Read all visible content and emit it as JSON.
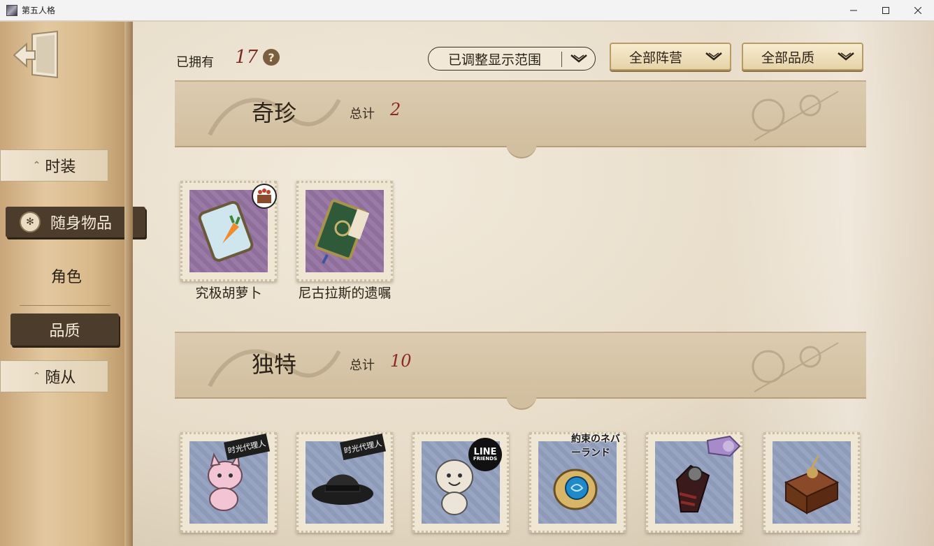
{
  "window": {
    "title": "第五人格",
    "minimize_icon": "minimize-icon",
    "maximize_icon": "maximize-icon",
    "close_icon": "close-icon"
  },
  "sidebar": {
    "back_icon": "exit-door-icon",
    "items": [
      {
        "label": "时装",
        "active": false
      },
      {
        "label": "随身物品",
        "active": true,
        "icon": "shield-emblem-icon"
      },
      {
        "label": "角色",
        "active": false
      },
      {
        "label": "品质",
        "active": true
      },
      {
        "label": "随从",
        "active": false
      }
    ]
  },
  "filter_bar": {
    "owned_label": "已拥有",
    "owned_count": "17",
    "help_icon": "question-icon",
    "help_text": "?",
    "range_dropdown": "已调整显示范围",
    "camp_dropdown": "全部阵营",
    "quality_dropdown": "全部品质"
  },
  "sections": [
    {
      "title": "奇珍",
      "total_label": "总计",
      "total_value": "2",
      "items": [
        {
          "name": "究极胡萝卜",
          "frame": "purple",
          "art": "carrot-jar-icon",
          "badge": "cake-icon"
        },
        {
          "name": "尼古拉斯的遗嘱",
          "frame": "purple",
          "art": "green-book-icon"
        }
      ]
    },
    {
      "title": "独特",
      "total_label": "总计",
      "total_value": "10",
      "items": [
        {
          "frame": "blue",
          "art": "pink-cat-plush-icon",
          "badge_text": "时光代理人"
        },
        {
          "frame": "blue",
          "art": "black-fedora-icon",
          "badge_text": "时光代理人"
        },
        {
          "frame": "blue",
          "art": "cony-plush-icon",
          "badge_line_top": "LINE",
          "badge_line_bottom": "FRIENDS"
        },
        {
          "frame": "blue",
          "art": "blue-gem-brooch-icon",
          "badge_text": "約束のネバーランド"
        },
        {
          "frame": "blue",
          "art": "dark-glove-icon",
          "badge": "purple-ribbon-icon"
        },
        {
          "frame": "blue",
          "art": "music-box-icon"
        }
      ]
    }
  ],
  "colors": {
    "accent_dark": "#4b3c2c",
    "count_red": "#8a2a22",
    "paper": "#e7dcc8"
  }
}
